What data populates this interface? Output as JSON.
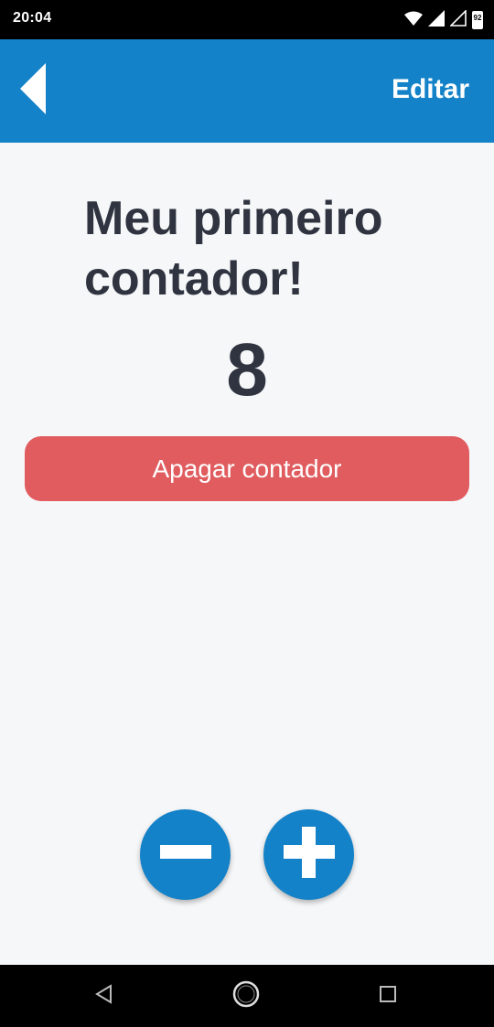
{
  "status_bar": {
    "time": "20:04",
    "battery_level": "92",
    "icons": [
      "wifi-icon",
      "signal-icon",
      "signal-empty-icon",
      "battery-icon"
    ]
  },
  "app_bar": {
    "back_icon": "back-arrow-icon",
    "edit_label": "Editar",
    "color": "#1482c8"
  },
  "counter": {
    "title": "Meu primeiro contador!",
    "value": "8"
  },
  "delete_button": {
    "label": "Apagar contador",
    "color": "#e05c5e"
  },
  "controls": {
    "decrement_icon": "minus-icon",
    "increment_icon": "plus-icon"
  },
  "nav_bar": {
    "icons": [
      "nav-back-icon",
      "nav-home-icon",
      "nav-recents-icon"
    ]
  }
}
